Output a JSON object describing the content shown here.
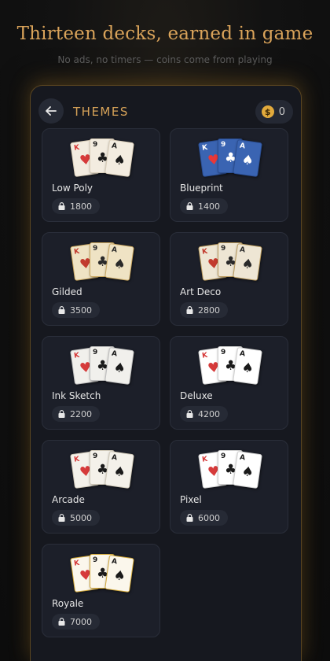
{
  "headline": "Thirteen decks, earned in game",
  "subheadline": "No ads, no timers — coins come from playing",
  "topbar": {
    "back_icon": "arrow-left-icon",
    "title": "THEMES",
    "coin_symbol": "$",
    "coins": "0"
  },
  "themes": [
    {
      "name": "Low Poly",
      "price": "1800",
      "style": "lowpoly"
    },
    {
      "name": "Blueprint",
      "price": "1400",
      "style": "blueprint"
    },
    {
      "name": "Gilded",
      "price": "3500",
      "style": "gilded"
    },
    {
      "name": "Art Deco",
      "price": "2800",
      "style": "artdeco"
    },
    {
      "name": "Ink Sketch",
      "price": "2200",
      "style": "ink"
    },
    {
      "name": "Deluxe",
      "price": "4200",
      "style": "deluxe"
    },
    {
      "name": "Arcade",
      "price": "5000",
      "style": "arcade"
    },
    {
      "name": "Pixel",
      "price": "6000",
      "style": "pixel"
    },
    {
      "name": "Royale",
      "price": "7000",
      "style": "royale"
    }
  ],
  "card_ranks": [
    "K",
    "9",
    "A"
  ],
  "colors": {
    "accent": "#d6a258",
    "background": "#16181f",
    "tile": "#1c1f29"
  }
}
